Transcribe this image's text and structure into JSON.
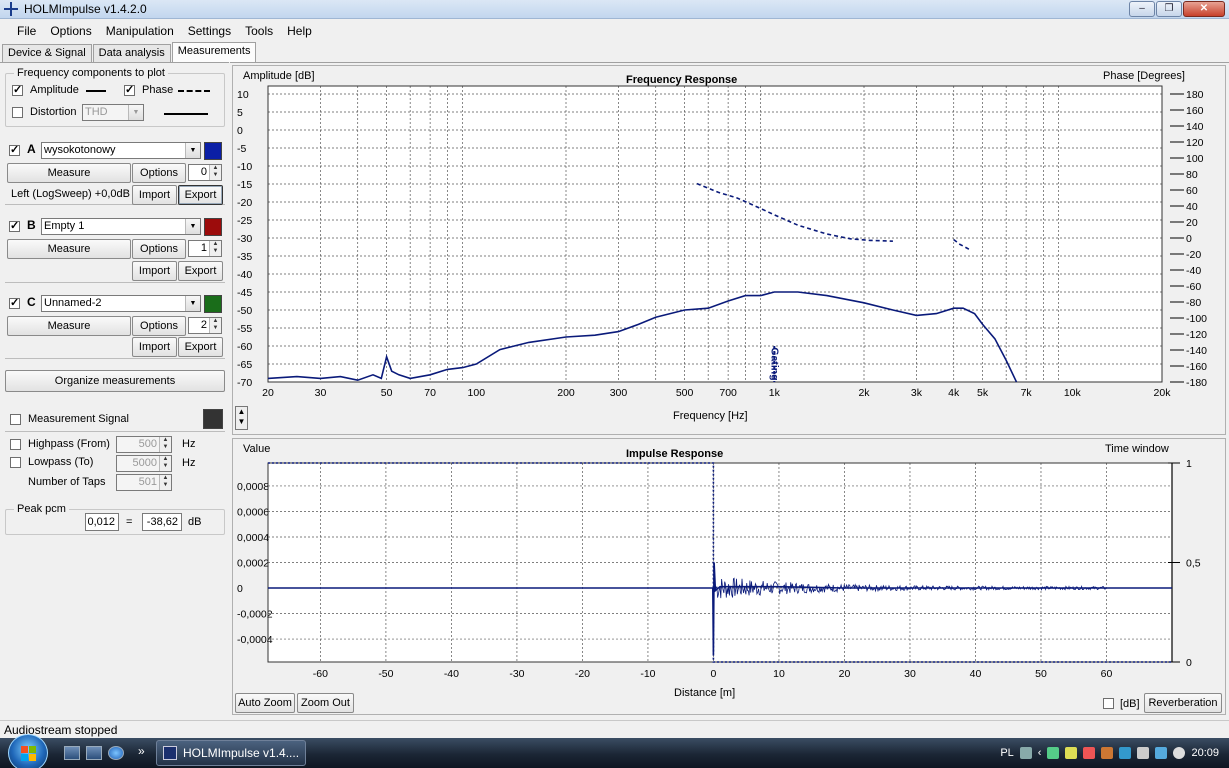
{
  "window": {
    "title": "HOLMImpulse  v1.4.2.0",
    "buttons": [
      "–",
      "❐",
      "✕"
    ]
  },
  "menu": [
    "File",
    "Options",
    "Manipulation",
    "Settings",
    "Tools",
    "Help"
  ],
  "tabs": [
    "Device & Signal",
    "Data analysis",
    "Measurements"
  ],
  "freq_components": {
    "legend": "Frequency components to plot",
    "amplitude_label": "Amplitude",
    "phase_label": "Phase",
    "distortion_label": "Distortion",
    "distortion_select": "THD"
  },
  "measurements": [
    {
      "letter": "A",
      "checked": true,
      "name": "wysokotonowy",
      "color": "#0b1fa6",
      "measure_label": "Measure",
      "options_label": "Options",
      "index": "0",
      "info": "Left (LogSweep) +0,0dB",
      "import_label": "Import",
      "export_label": "Export"
    },
    {
      "letter": "B",
      "checked": true,
      "name": "Empty 1",
      "color": "#9c0c0c",
      "measure_label": "Measure",
      "options_label": "Options",
      "index": "1",
      "info": "",
      "import_label": "Import",
      "export_label": "Export"
    },
    {
      "letter": "C",
      "checked": true,
      "name": "Unnamed-2",
      "color": "#1a6d1a",
      "measure_label": "Measure",
      "options_label": "Options",
      "index": "2",
      "info": "",
      "import_label": "Import",
      "export_label": "Export"
    }
  ],
  "organize_label": "Organize measurements",
  "signal": {
    "measurement_signal_label": "Measurement Signal",
    "highpass_label": "Highpass (From)",
    "highpass_value": "500",
    "lowpass_label": "Lowpass (To)",
    "lowpass_value": "5000",
    "taps_label": "Number of Taps",
    "taps_value": "501",
    "hz": "Hz",
    "swatch_color": "#333333"
  },
  "peak": {
    "legend": "Peak pcm",
    "value": "0,012",
    "equals": "=",
    "db_value": "-38,62",
    "db_unit": "dB"
  },
  "freq_plot": {
    "title": "Frequency Response",
    "y_left_label": "Amplitude [dB]",
    "y_right_label": "Phase [Degrees]",
    "x_label": "Frequency [Hz]",
    "gating_label": "Gating",
    "y_left_ticks": [
      "10",
      "5",
      "0",
      "-5",
      "-10",
      "-15",
      "-20",
      "-25",
      "-30",
      "-35",
      "-40",
      "-45",
      "-50",
      "-55",
      "-60",
      "-65",
      "-70"
    ],
    "y_right_ticks": [
      "180",
      "160",
      "140",
      "120",
      "100",
      "80",
      "60",
      "40",
      "20",
      "0",
      "-20",
      "-40",
      "-60",
      "-80",
      "-100",
      "-120",
      "-140",
      "-160",
      "-180"
    ],
    "x_ticks": [
      "20",
      "30",
      "50",
      "70",
      "100",
      "200",
      "300",
      "500",
      "700",
      "1k",
      "2k",
      "3k",
      "4k",
      "5k",
      "7k",
      "10k",
      "20k"
    ]
  },
  "impulse_plot": {
    "title": "Impulse Response",
    "y_left_label": "Value",
    "y_right_label": "Time window",
    "x_label": "Distance [m]",
    "y_left_ticks": [
      "0,0008",
      "0,0006",
      "0,0004",
      "0,0002",
      "0",
      "-0,0002",
      "-0,0004"
    ],
    "y_right_ticks": [
      "1",
      "0,5",
      "0"
    ],
    "x_ticks": [
      "-60",
      "-50",
      "-40",
      "-30",
      "-20",
      "-10",
      "0",
      "10",
      "20",
      "30",
      "40",
      "50",
      "60"
    ],
    "auto_zoom_label": "Auto Zoom",
    "zoom_out_label": "Zoom Out",
    "db_label": "[dB]",
    "reverberation_label": "Reverberation"
  },
  "chart_data": [
    {
      "type": "line",
      "title": "Frequency Response",
      "xlabel": "Frequency [Hz]",
      "ylabel": "Amplitude [dB]",
      "y2label": "Phase [Degrees]",
      "xscale": "log",
      "xlim": [
        20,
        20000
      ],
      "ylim": [
        -70,
        10
      ],
      "y2lim": [
        -180,
        180
      ],
      "grid": true,
      "series": [
        {
          "style": "solid",
          "axis": "left",
          "x": [
            20,
            25,
            30,
            35,
            40,
            45,
            48,
            50,
            52,
            55,
            60,
            70,
            80,
            90,
            100,
            120,
            150,
            200,
            250,
            300,
            350,
            400,
            500,
            600,
            700,
            800,
            900,
            1000,
            1200,
            1500,
            2000,
            2500,
            3000,
            3500,
            4000,
            4300,
            4700,
            5000,
            5500,
            6000,
            6500
          ],
          "y": [
            -69,
            -68.5,
            -69,
            -68.5,
            -69.5,
            -68,
            -69,
            -63,
            -67,
            -68,
            -69,
            -68,
            -66.5,
            -66,
            -65,
            -61,
            -59,
            -57.5,
            -57,
            -56,
            -54,
            -52,
            -50,
            -49.5,
            -47.5,
            -46,
            -46,
            -45,
            -45,
            -46,
            -48,
            -50,
            -51.5,
            -51,
            -49.5,
            -49.5,
            -51,
            -54,
            -58,
            -64,
            -70
          ]
        },
        {
          "style": "dashed",
          "axis": "right",
          "x": [
            550,
            650,
            750,
            850,
            1000,
            1200,
            1500,
            1800,
            2100,
            2500
          ],
          "y": [
            68,
            57,
            50,
            41,
            29,
            16,
            5,
            -1,
            -3,
            -4
          ]
        },
        {
          "style": "dashed",
          "axis": "right",
          "x": [
            4000,
            4200,
            4500
          ],
          "y": [
            -2,
            -8,
            -14
          ]
        }
      ]
    },
    {
      "type": "line",
      "title": "Impulse Response",
      "xlabel": "Distance [m]",
      "ylabel": "Value",
      "y2label": "Time window",
      "xlim": [
        -68,
        70
      ],
      "ylim": [
        -0.00058,
        0.00098
      ],
      "y2lim": [
        0,
        1
      ],
      "grid": true,
      "series": [
        {
          "style": "solid",
          "axis": "left",
          "x": [
            -68,
            -0.1,
            0,
            0.1,
            0.3,
            1,
            5,
            10,
            20,
            30,
            40,
            50,
            60,
            70
          ],
          "y": [
            0,
            0,
            -0.00052,
            0.0002,
            -2e-05,
            1e-05,
            1e-05,
            1e-05,
            0,
            0,
            0,
            0,
            0,
            0
          ]
        },
        {
          "style": "dotted",
          "axis": "right",
          "x": [
            -68,
            0,
            0,
            70
          ],
          "y": [
            1,
            1,
            0,
            0
          ]
        }
      ]
    }
  ],
  "status": "Audiostream stopped",
  "taskbar": {
    "task_label": "HOLMImpulse  v1.4....",
    "language": "PL",
    "time": "20:09"
  }
}
